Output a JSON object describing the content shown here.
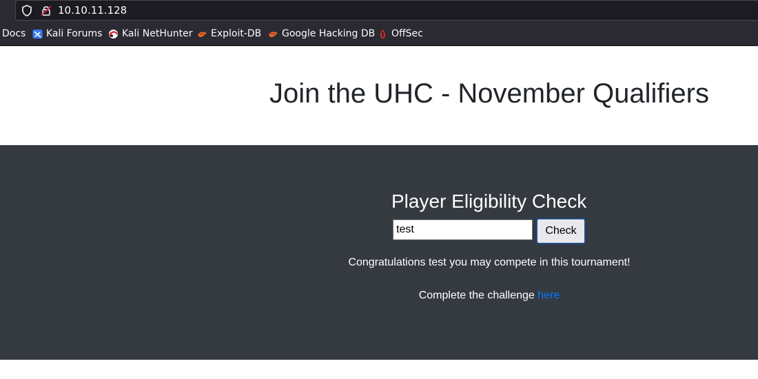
{
  "browser": {
    "url": "10.10.11.128",
    "bookmarks": [
      {
        "label": "Docs",
        "icon": "none"
      },
      {
        "label": "Kali Forums",
        "icon": "kali-forums-icon"
      },
      {
        "label": "Kali NetHunter",
        "icon": "kali-nethunter-icon"
      },
      {
        "label": "Exploit-DB",
        "icon": "exploit-db-icon"
      },
      {
        "label": "Google Hacking DB",
        "icon": "ghdb-icon"
      },
      {
        "label": "OffSec",
        "icon": "offsec-icon"
      }
    ]
  },
  "header": {
    "title": "Join the UHC - November Qualifiers"
  },
  "main": {
    "heading": "Player Eligibility Check",
    "input_value": "test",
    "check_label": "Check",
    "result_message": "Congratulations test you may compete in this tournament!",
    "challenge_text": "Complete the challenge",
    "challenge_link": "here"
  },
  "colors": {
    "dark_panel": "#343a40",
    "link": "#007bff"
  }
}
